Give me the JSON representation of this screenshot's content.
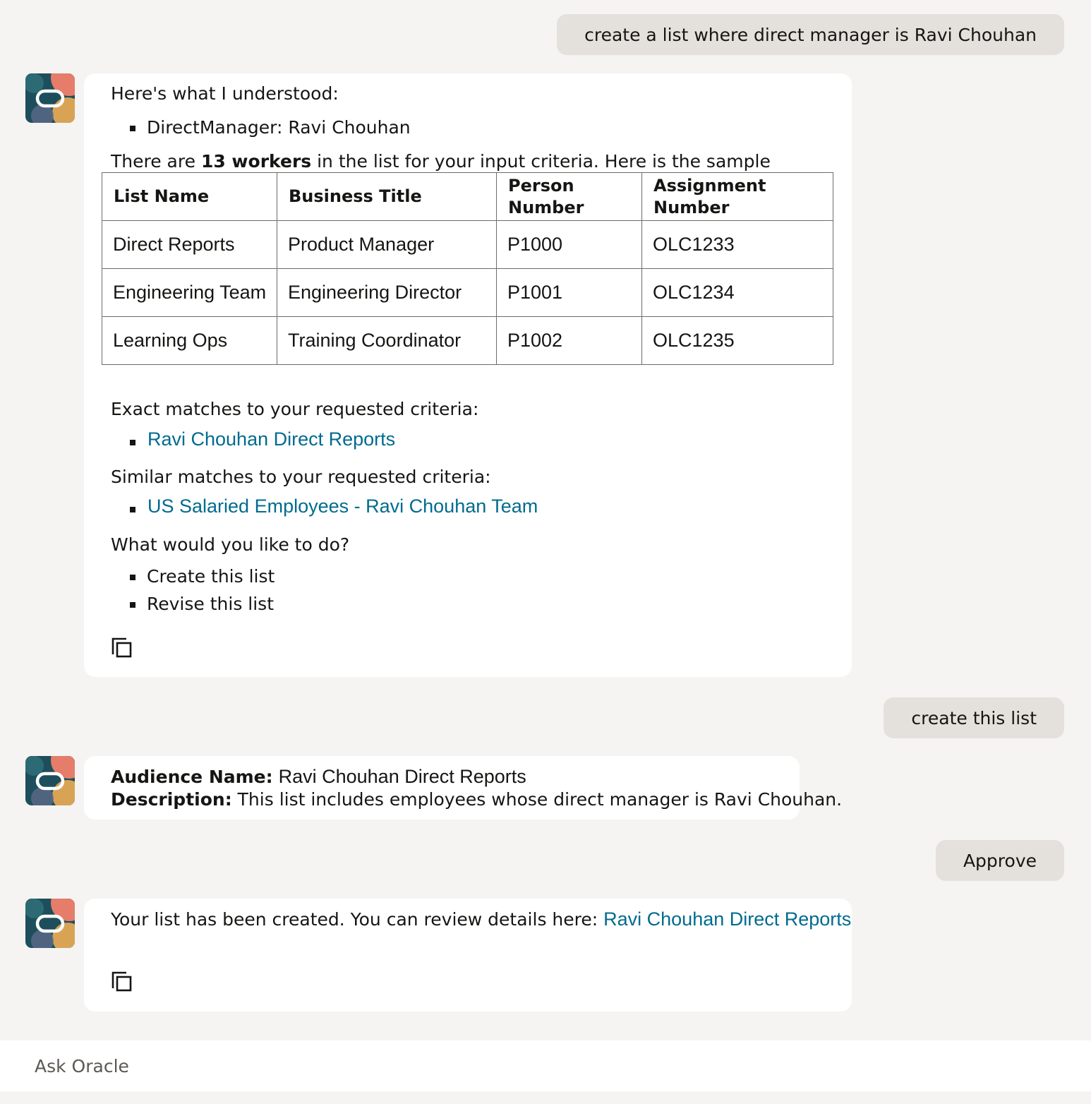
{
  "messages": {
    "user1": "create a list where direct manager is Ravi Chouhan",
    "bot1": {
      "understood_heading": "Here's what I understood:",
      "criteria": [
        "DirectManager: Ravi Chouhan"
      ],
      "count_prefix": "There are ",
      "count_bold": "13 workers",
      "count_suffix": " in the list for your input criteria. Here is the sample",
      "table": {
        "headers": [
          "List Name",
          "Business Title",
          "Person\nNumber",
          "Assignment Number"
        ],
        "rows": [
          [
            "Direct Reports",
            "Product Manager",
            "P1000",
            "OLC1233"
          ],
          [
            "Engineering Team",
            "Engineering Director",
            "P1001",
            "OLC1234"
          ],
          [
            "Learning Ops",
            "Training Coordinator",
            "P1002",
            "OLC1235"
          ]
        ]
      },
      "exact_heading": "Exact matches to your requested criteria:",
      "exact_links": [
        "Ravi Chouhan Direct Reports"
      ],
      "similar_heading": "Similar matches to your requested criteria:",
      "similar_links": [
        "US Salaried Employees - Ravi Chouhan Team"
      ],
      "action_heading": "What would you like to do?",
      "actions": [
        "Create this list",
        "Revise this list"
      ]
    },
    "user2": "create this list",
    "bot2": {
      "audience_label": "Audience Name:",
      "audience_value": "Ravi Chouhan Direct Reports",
      "description_label": "Description:",
      "description_value": "This list includes employees whose direct manager is Ravi Chouhan."
    },
    "user3": "Approve",
    "bot3": {
      "text": "Your list has been created. You can review details here:",
      "link": "Ravi Chouhan Direct Reports"
    }
  },
  "input": {
    "placeholder": "Ask Oracle"
  },
  "icons": {
    "avatar": "oracle-logo-icon",
    "copy": "copy-icon"
  },
  "colors": {
    "background": "#f5f4f2",
    "user_bubble": "#e4e1dc",
    "link": "#006b8f"
  }
}
